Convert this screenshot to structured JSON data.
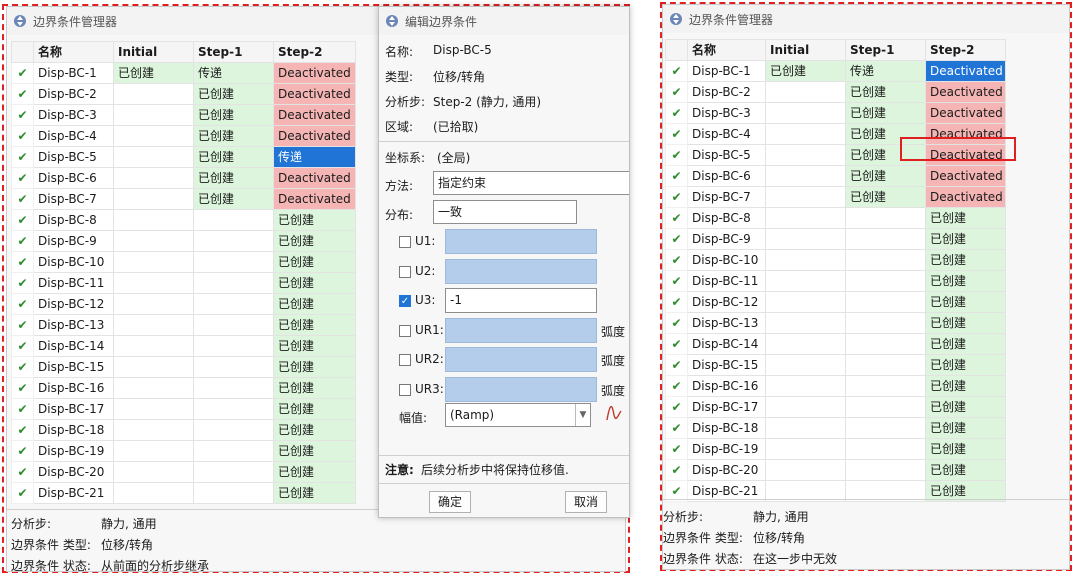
{
  "left_window": {
    "title": "边界条件管理器",
    "headers": [
      "名称",
      "Initial",
      "Step-1",
      "Step-2"
    ],
    "rows": [
      {
        "name": "Disp-BC-1",
        "initial": "已创建",
        "step1": "传递",
        "step2": "Deactivated",
        "s1": "prop",
        "s2": "deact"
      },
      {
        "name": "Disp-BC-2",
        "initial": "",
        "step1": "已创建",
        "step2": "Deactivated",
        "s1": "created",
        "s2": "deact"
      },
      {
        "name": "Disp-BC-3",
        "initial": "",
        "step1": "已创建",
        "step2": "Deactivated",
        "s1": "created",
        "s2": "deact"
      },
      {
        "name": "Disp-BC-4",
        "initial": "",
        "step1": "已创建",
        "step2": "Deactivated",
        "s1": "created",
        "s2": "deact"
      },
      {
        "name": "Disp-BC-5",
        "initial": "",
        "step1": "已创建",
        "step2": "传递",
        "s1": "created",
        "s2": "sel"
      },
      {
        "name": "Disp-BC-6",
        "initial": "",
        "step1": "已创建",
        "step2": "Deactivated",
        "s1": "created",
        "s2": "deact"
      },
      {
        "name": "Disp-BC-7",
        "initial": "",
        "step1": "已创建",
        "step2": "Deactivated",
        "s1": "created",
        "s2": "deact"
      },
      {
        "name": "Disp-BC-8",
        "initial": "",
        "step1": "",
        "step2": "已创建",
        "s1": "",
        "s2": "created"
      },
      {
        "name": "Disp-BC-9",
        "initial": "",
        "step1": "",
        "step2": "已创建",
        "s1": "",
        "s2": "created"
      },
      {
        "name": "Disp-BC-10",
        "initial": "",
        "step1": "",
        "step2": "已创建",
        "s1": "",
        "s2": "created"
      },
      {
        "name": "Disp-BC-11",
        "initial": "",
        "step1": "",
        "step2": "已创建",
        "s1": "",
        "s2": "created"
      },
      {
        "name": "Disp-BC-12",
        "initial": "",
        "step1": "",
        "step2": "已创建",
        "s1": "",
        "s2": "created"
      },
      {
        "name": "Disp-BC-13",
        "initial": "",
        "step1": "",
        "step2": "已创建",
        "s1": "",
        "s2": "created"
      },
      {
        "name": "Disp-BC-14",
        "initial": "",
        "step1": "",
        "step2": "已创建",
        "s1": "",
        "s2": "created"
      },
      {
        "name": "Disp-BC-15",
        "initial": "",
        "step1": "",
        "step2": "已创建",
        "s1": "",
        "s2": "created"
      },
      {
        "name": "Disp-BC-16",
        "initial": "",
        "step1": "",
        "step2": "已创建",
        "s1": "",
        "s2": "created"
      },
      {
        "name": "Disp-BC-17",
        "initial": "",
        "step1": "",
        "step2": "已创建",
        "s1": "",
        "s2": "created"
      },
      {
        "name": "Disp-BC-18",
        "initial": "",
        "step1": "",
        "step2": "已创建",
        "s1": "",
        "s2": "created"
      },
      {
        "name": "Disp-BC-19",
        "initial": "",
        "step1": "",
        "step2": "已创建",
        "s1": "",
        "s2": "created"
      },
      {
        "name": "Disp-BC-20",
        "initial": "",
        "step1": "",
        "step2": "已创建",
        "s1": "",
        "s2": "created"
      },
      {
        "name": "Disp-BC-21",
        "initial": "",
        "step1": "",
        "step2": "已创建",
        "s1": "",
        "s2": "created"
      }
    ],
    "status": [
      {
        "k": "分析步:",
        "v": "静力, 通用"
      },
      {
        "k": "边界条件 类型:",
        "v": "位移/转角"
      },
      {
        "k": "边界条件 状态:",
        "v": "从前面的分析步继承"
      }
    ]
  },
  "dialog": {
    "title": "编辑边界条件",
    "name_label": "名称:",
    "name_value": "Disp-BC-5",
    "type_label": "类型:",
    "type_value": "位移/转角",
    "step_label": "分析步:",
    "step_value": "Step-2 (静力, 通用)",
    "region_label": "区域:",
    "region_value": "(已拾取)",
    "csys_label": "坐标系:",
    "csys_value": "(全局)",
    "method_label": "方法:",
    "method_value": "指定约束",
    "dist_label": "分布:",
    "dist_value": "一致",
    "dofs": [
      {
        "label": "U1:",
        "checked": false,
        "value": "",
        "unit": ""
      },
      {
        "label": "U2:",
        "checked": false,
        "value": "",
        "unit": ""
      },
      {
        "label": "U3:",
        "checked": true,
        "value": "-1",
        "unit": ""
      },
      {
        "label": "UR1:",
        "checked": false,
        "value": "",
        "unit": "弧度"
      },
      {
        "label": "UR2:",
        "checked": false,
        "value": "",
        "unit": "弧度"
      },
      {
        "label": "UR3:",
        "checked": false,
        "value": "",
        "unit": "弧度"
      }
    ],
    "amp_label": "幅值:",
    "amp_value": "(Ramp)",
    "note_label": "注意:",
    "note_text": "后续分析步中将保持位移值.",
    "ok": "确定",
    "cancel": "取消"
  },
  "right_window": {
    "title": "边界条件管理器",
    "headers": [
      "名称",
      "Initial",
      "Step-1",
      "Step-2"
    ],
    "rows": [
      {
        "name": "Disp-BC-1",
        "initial": "已创建",
        "step1": "传递",
        "step2": "Deactivated",
        "s1": "prop",
        "s2": "sel"
      },
      {
        "name": "Disp-BC-2",
        "initial": "",
        "step1": "已创建",
        "step2": "Deactivated",
        "s1": "created",
        "s2": "deact"
      },
      {
        "name": "Disp-BC-3",
        "initial": "",
        "step1": "已创建",
        "step2": "Deactivated",
        "s1": "created",
        "s2": "deact"
      },
      {
        "name": "Disp-BC-4",
        "initial": "",
        "step1": "已创建",
        "step2": "Deactivated",
        "s1": "created",
        "s2": "deact"
      },
      {
        "name": "Disp-BC-5",
        "initial": "",
        "step1": "已创建",
        "step2": "Deactivated",
        "s1": "created",
        "s2": "deact"
      },
      {
        "name": "Disp-BC-6",
        "initial": "",
        "step1": "已创建",
        "step2": "Deactivated",
        "s1": "created",
        "s2": "deact"
      },
      {
        "name": "Disp-BC-7",
        "initial": "",
        "step1": "已创建",
        "step2": "Deactivated",
        "s1": "created",
        "s2": "deact"
      },
      {
        "name": "Disp-BC-8",
        "initial": "",
        "step1": "",
        "step2": "已创建",
        "s1": "",
        "s2": "created"
      },
      {
        "name": "Disp-BC-9",
        "initial": "",
        "step1": "",
        "step2": "已创建",
        "s1": "",
        "s2": "created"
      },
      {
        "name": "Disp-BC-10",
        "initial": "",
        "step1": "",
        "step2": "已创建",
        "s1": "",
        "s2": "created"
      },
      {
        "name": "Disp-BC-11",
        "initial": "",
        "step1": "",
        "step2": "已创建",
        "s1": "",
        "s2": "created"
      },
      {
        "name": "Disp-BC-12",
        "initial": "",
        "step1": "",
        "step2": "已创建",
        "s1": "",
        "s2": "created"
      },
      {
        "name": "Disp-BC-13",
        "initial": "",
        "step1": "",
        "step2": "已创建",
        "s1": "",
        "s2": "created"
      },
      {
        "name": "Disp-BC-14",
        "initial": "",
        "step1": "",
        "step2": "已创建",
        "s1": "",
        "s2": "created"
      },
      {
        "name": "Disp-BC-15",
        "initial": "",
        "step1": "",
        "step2": "已创建",
        "s1": "",
        "s2": "created"
      },
      {
        "name": "Disp-BC-16",
        "initial": "",
        "step1": "",
        "step2": "已创建",
        "s1": "",
        "s2": "created"
      },
      {
        "name": "Disp-BC-17",
        "initial": "",
        "step1": "",
        "step2": "已创建",
        "s1": "",
        "s2": "created"
      },
      {
        "name": "Disp-BC-18",
        "initial": "",
        "step1": "",
        "step2": "已创建",
        "s1": "",
        "s2": "created"
      },
      {
        "name": "Disp-BC-19",
        "initial": "",
        "step1": "",
        "step2": "已创建",
        "s1": "",
        "s2": "created"
      },
      {
        "name": "Disp-BC-20",
        "initial": "",
        "step1": "",
        "step2": "已创建",
        "s1": "",
        "s2": "created"
      },
      {
        "name": "Disp-BC-21",
        "initial": "",
        "step1": "",
        "step2": "已创建",
        "s1": "",
        "s2": "created"
      }
    ],
    "status": [
      {
        "k": "分析步:",
        "v": "静力, 通用"
      },
      {
        "k": "边界条件 类型:",
        "v": "位移/转角"
      },
      {
        "k": "边界条件 状态:",
        "v": "在这一步中无效"
      }
    ]
  },
  "colors": {
    "created": "#dcf5dc",
    "deactivated": "#f5b5b5",
    "selected": "#1f74d6",
    "annotation": "#e02020"
  }
}
